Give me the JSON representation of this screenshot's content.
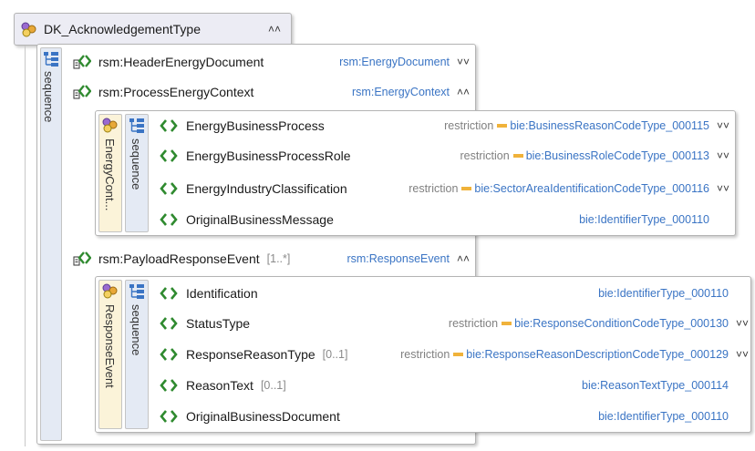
{
  "root": {
    "title": "DK_AcknowledgementType"
  },
  "outer_sequence": {
    "label": "sequence"
  },
  "header_element": {
    "name": "rsm:HeaderEnergyDocument",
    "type": "rsm:EnergyDocument"
  },
  "process_element": {
    "name": "rsm:ProcessEnergyContext",
    "type": "rsm:EnergyContext",
    "complex_label": "EnergyCont...",
    "sequence_label": "sequence",
    "children": [
      {
        "name": "EnergyBusinessProcess",
        "occurs": "",
        "restriction": "restriction",
        "type": "bie:BusinessReasonCodeType_000115",
        "expandable": true
      },
      {
        "name": "EnergyBusinessProcessRole",
        "occurs": "",
        "restriction": "restriction",
        "type": "bie:BusinessRoleCodeType_000113",
        "expandable": true
      },
      {
        "name": "EnergyIndustryClassification",
        "occurs": "",
        "restriction": "restriction",
        "type": "bie:SectorAreaIdentificationCodeType_000116",
        "expandable": true
      },
      {
        "name": "OriginalBusinessMessage",
        "occurs": "",
        "restriction": "",
        "type": "bie:IdentifierType_000110",
        "expandable": false
      }
    ]
  },
  "payload_element": {
    "name": "rsm:PayloadResponseEvent",
    "occurs": "[1..*]",
    "type": "rsm:ResponseEvent",
    "complex_label": "ResponseEvent",
    "sequence_label": "sequence",
    "children": [
      {
        "name": "Identification",
        "occurs": "",
        "restriction": "",
        "type": "bie:IdentifierType_000110",
        "expandable": false
      },
      {
        "name": "StatusType",
        "occurs": "",
        "restriction": "restriction",
        "type": "bie:ResponseConditionCodeType_000130",
        "expandable": true
      },
      {
        "name": "ResponseReasonType",
        "occurs": "[0..1]",
        "restriction": "restriction",
        "type": "bie:ResponseReasonDescriptionCodeType_000129",
        "expandable": true
      },
      {
        "name": "ReasonText",
        "occurs": "[0..1]",
        "restriction": "",
        "type": "bie:ReasonTextType_000114",
        "expandable": false
      },
      {
        "name": "OriginalBusinessDocument",
        "occurs": "",
        "restriction": "",
        "type": "bie:IdentifierType_000110",
        "expandable": false
      }
    ]
  },
  "icons": {
    "complex_type": "complex-type-icon",
    "sequence": "sequence-icon",
    "complex_element": "complex-element-icon",
    "simple_element": "simple-element-icon",
    "restriction": "restriction-icon",
    "expand": "double-chevron-down-icon",
    "collapse": "double-chevron-up-icon"
  },
  "colors": {
    "type_text": "#3a74c4",
    "restriction_marker": "#f0b23a",
    "complex_band": "#fbf3d9",
    "sequence_band": "#e4eaf4"
  }
}
